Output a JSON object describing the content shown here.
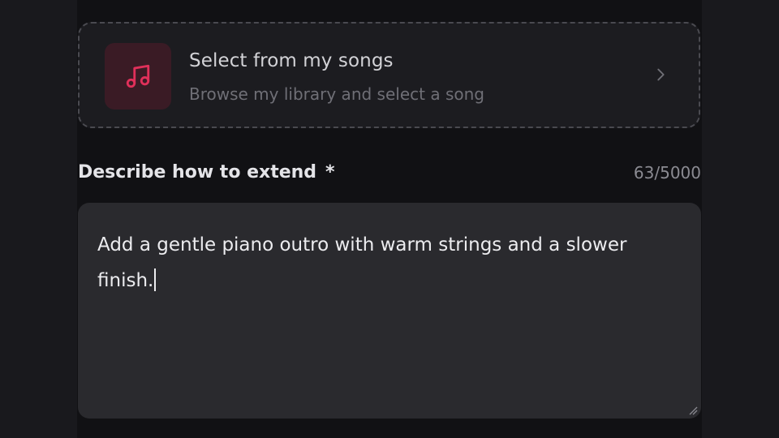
{
  "source_picker": {
    "title": "Select from my songs",
    "subtitle": "Browse my library and select a song",
    "icon": "music-note-icon",
    "accent_color": "#e0305a"
  },
  "description_field": {
    "label": "Describe how to extend",
    "required_marker": "*",
    "char_count": "63/5000",
    "value": "Add a gentle piano outro with warm strings and a slower finish."
  }
}
